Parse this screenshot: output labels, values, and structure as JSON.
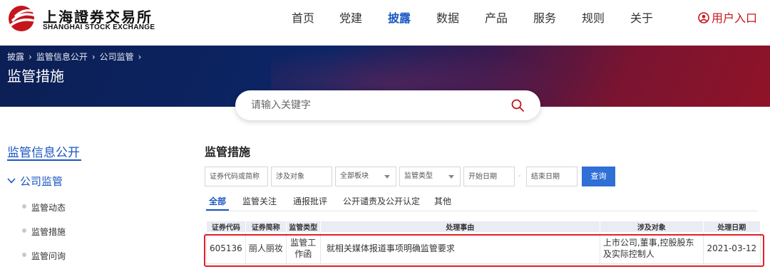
{
  "header": {
    "logo_cn": "上海證券交易所",
    "logo_en": "SHANGHAI STOCK EXCHANGE",
    "nav": [
      {
        "label": "首页",
        "name": "nav-home"
      },
      {
        "label": "党建",
        "name": "nav-party"
      },
      {
        "label": "披露",
        "name": "nav-disclosure",
        "active": true
      },
      {
        "label": "数据",
        "name": "nav-data"
      },
      {
        "label": "产品",
        "name": "nav-products"
      },
      {
        "label": "服务",
        "name": "nav-services"
      },
      {
        "label": "规则",
        "name": "nav-rules"
      },
      {
        "label": "关于",
        "name": "nav-about"
      }
    ],
    "login": "用户入口",
    "login_icon": "user-circle-icon"
  },
  "banner": {
    "breadcrumb": [
      "披露",
      "监管信息公开",
      "公司监管"
    ],
    "title": "监管措施"
  },
  "search": {
    "placeholder": "请输入关键字",
    "icon": "search-icon"
  },
  "sidebar": {
    "title": "监管信息公开",
    "group": "公司监管",
    "items": [
      "监管动态",
      "监管措施",
      "监管问询"
    ]
  },
  "main": {
    "title": "监管措施",
    "filters": {
      "code_placeholder": "证券代码或简称",
      "target_placeholder": "涉及对象",
      "board": "全部板块",
      "type": "监管类型",
      "start_placeholder": "开始日期",
      "end_placeholder": "结束日期",
      "dash": "-",
      "query": "查询"
    },
    "tabs": [
      "全部",
      "监管关注",
      "通报批评",
      "公开谴责及公开认定",
      "其他"
    ],
    "table": {
      "headers": [
        "证券代码",
        "证券简称",
        "监管类型",
        "处理事由",
        "涉及对象",
        "处理日期"
      ],
      "rows": [
        [
          "605136",
          "丽人丽妆",
          "监管工作函",
          "就相关媒体报道事项明确监管要求",
          "上市公司,董事,控股股东及实际控制人",
          "2021-03-12"
        ]
      ]
    }
  },
  "colors": {
    "accent_blue": "#1a56c4",
    "brand_red": "#c4161c",
    "highlight_red": "#e0202a",
    "query_button": "#2f6fd6"
  }
}
